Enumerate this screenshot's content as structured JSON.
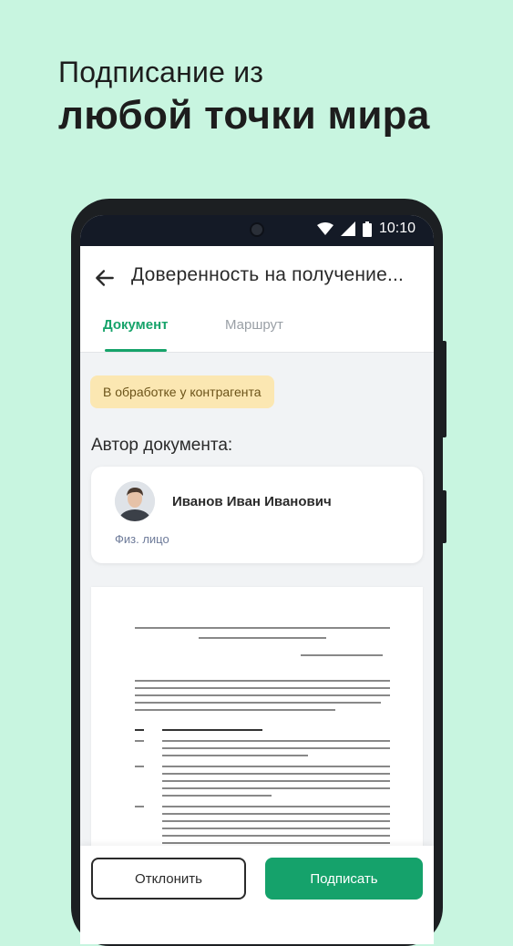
{
  "promo": {
    "line1": "Подписание из",
    "line2": "любой точки мира"
  },
  "statusbar": {
    "time": "10:10",
    "icons": [
      "wifi-icon",
      "signal-icon",
      "battery-icon"
    ]
  },
  "appbar": {
    "title": "Доверенность на получение..."
  },
  "tabs": [
    {
      "label": "Документ",
      "active": true
    },
    {
      "label": "Маршрут",
      "active": false
    }
  ],
  "status_badge": "В обработке у контрагента",
  "author": {
    "section_title": "Автор документа:",
    "name": "Иванов Иван Иванович",
    "type": "Физ. лицо"
  },
  "actions": {
    "reject": "Отклонить",
    "sign": "Подписать"
  },
  "colors": {
    "background": "#c8f5e0",
    "accent": "#15a26b",
    "badge_bg": "#fbe7b2"
  }
}
